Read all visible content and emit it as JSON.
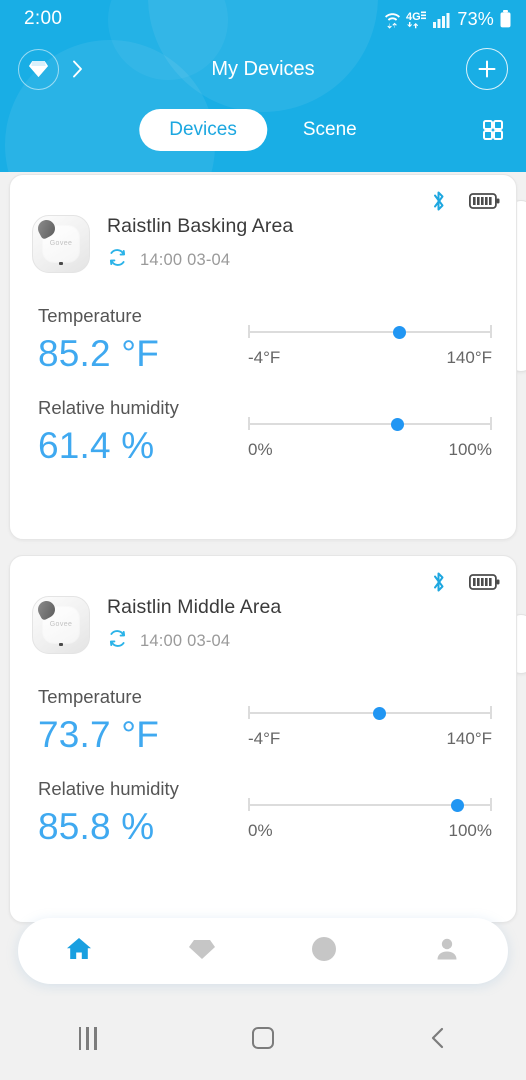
{
  "status_bar": {
    "clock": "2:00",
    "wifi_icon": "wifi-icon",
    "network_type": "4G",
    "signal_icon": "cellular-signal-icon",
    "battery_percent": "73%",
    "battery_icon": "battery-icon"
  },
  "header": {
    "logo_icon": "diamond-logo-icon",
    "expand_icon": "chevron-right-icon",
    "title": "My Devices",
    "add_icon": "plus-icon",
    "grid_icon": "grid-view-icon",
    "accent_color": "#19aee5",
    "tabs": [
      {
        "label": "Devices",
        "active": true
      },
      {
        "label": "Scene",
        "active": false
      }
    ]
  },
  "devices": [
    {
      "name": "Raistlin Basking Area",
      "thumb_brand": "Govee",
      "sync_icon": "sync-refresh-icon",
      "sync_time": "14:00 03-04",
      "bluetooth_icon": "bluetooth-icon",
      "bluetooth_color": "#1ea7e0",
      "battery_icon": "battery-full-icon",
      "metrics": [
        {
          "label": "Temperature",
          "value": "85.2 °F",
          "min_label": "-4°F",
          "max_label": "140°F",
          "min": -4,
          "max": 140,
          "current": 85.2,
          "percent": 62
        },
        {
          "label": "Relative humidity",
          "value": "61.4 %",
          "min_label": "0%",
          "max_label": "100%",
          "min": 0,
          "max": 100,
          "current": 61.4,
          "percent": 61.4
        }
      ]
    },
    {
      "name": "Raistlin Middle Area",
      "thumb_brand": "Govee",
      "sync_icon": "sync-refresh-icon",
      "sync_time": "14:00 03-04",
      "bluetooth_icon": "bluetooth-icon",
      "bluetooth_color": "#1ea7e0",
      "battery_icon": "battery-full-icon",
      "metrics": [
        {
          "label": "Temperature",
          "value": "73.7 °F",
          "min_label": "-4°F",
          "max_label": "140°F",
          "min": -4,
          "max": 140,
          "current": 73.7,
          "percent": 54
        },
        {
          "label": "Relative humidity",
          "value": "85.8 %",
          "min_label": "0%",
          "max_label": "100%",
          "min": 0,
          "max": 100,
          "current": 85.8,
          "percent": 85.8
        }
      ]
    }
  ],
  "bottom_nav": {
    "active_color": "#199fe0",
    "inactive_color": "#c6c6c6",
    "items": [
      {
        "icon": "home-icon",
        "active": true
      },
      {
        "icon": "diamond-icon",
        "active": false
      },
      {
        "icon": "compass-icon",
        "active": false
      },
      {
        "icon": "profile-person-icon",
        "active": false
      }
    ]
  },
  "system_nav": {
    "recents_icon": "recents-icon",
    "home_icon": "home-square-icon",
    "back_icon": "back-chevron-icon"
  }
}
